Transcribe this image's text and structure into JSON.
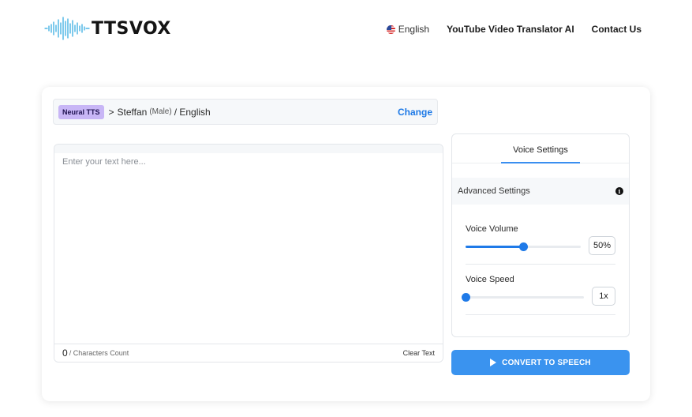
{
  "header": {
    "brand": "TTSVOX",
    "logo_icon": "soundwave-icon",
    "nav": {
      "language": "English",
      "language_icon": "us-flag-icon",
      "links": [
        "YouTube Video Translator AI",
        "Contact Us"
      ]
    }
  },
  "voice": {
    "engine_badge": "Neural TTS",
    "separator": ">",
    "name": "Steffan",
    "gender": "(Male)",
    "language": "/ English",
    "change_label": "Change"
  },
  "editor": {
    "placeholder": "Enter your text here...",
    "value": "",
    "char_count": "0",
    "char_count_label": "/ Characters Count",
    "clear_label": "Clear Text"
  },
  "settings": {
    "tab": "Voice Settings",
    "advanced_label": "Advanced Settings",
    "info_icon": "info-icon",
    "volume": {
      "label": "Voice Volume",
      "value_text": "50%",
      "fraction": 0.5
    },
    "speed": {
      "label": "Voice Speed",
      "value_text": "1x",
      "fraction": 0.0
    }
  },
  "convert": {
    "label": "CONVERT TO SPEECH",
    "icon": "play-icon"
  },
  "colors": {
    "accent": "#1f7ae8",
    "button": "#3a93ef",
    "badge": "#c8b6f6",
    "link": "#1d79e6"
  }
}
